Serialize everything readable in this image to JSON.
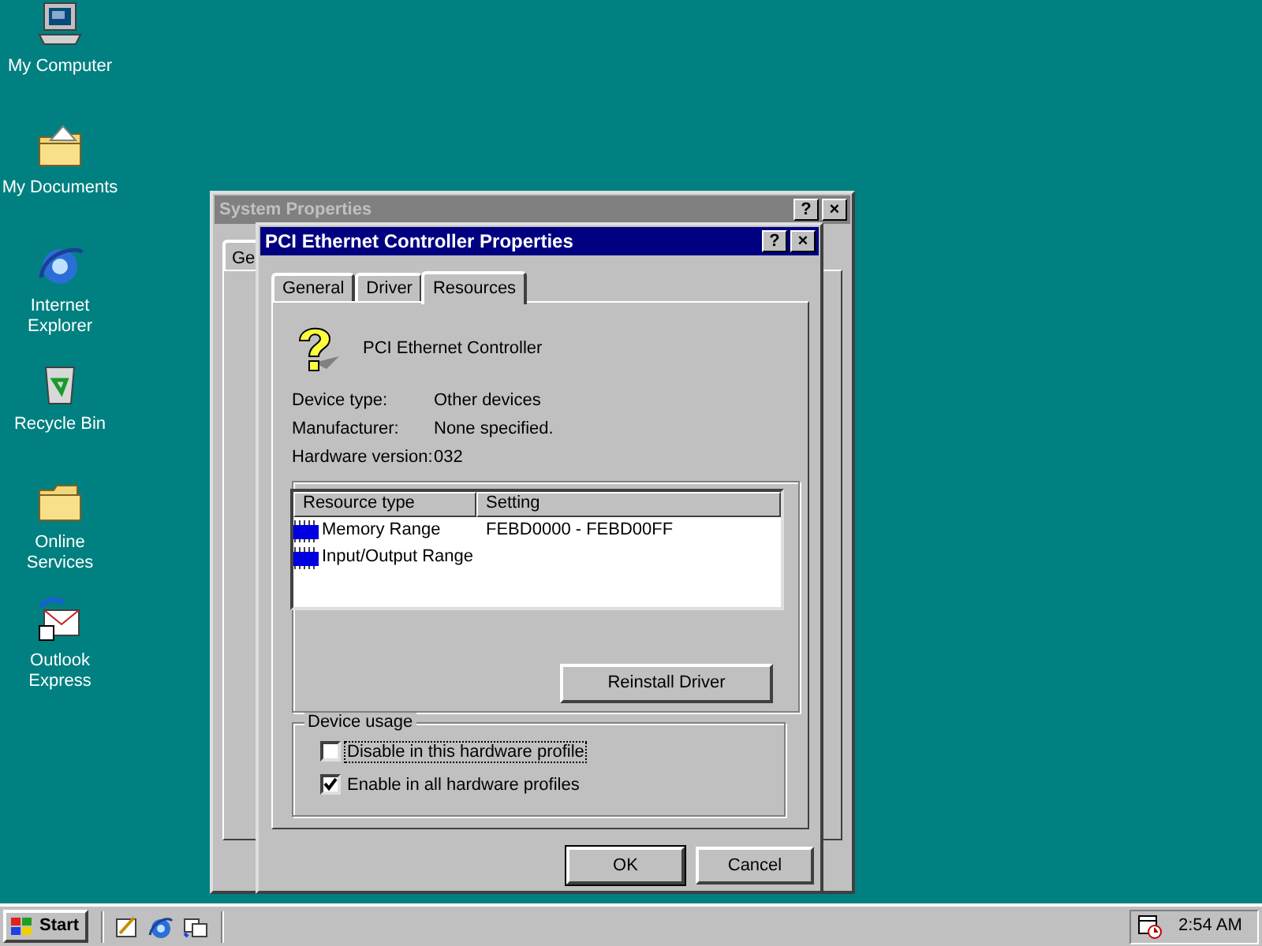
{
  "desktop_icons": [
    {
      "label": "My Computer",
      "kind": "computer"
    },
    {
      "label": "My Documents",
      "kind": "documents"
    },
    {
      "label": "Internet Explorer",
      "kind": "browser"
    },
    {
      "label": "Recycle Bin",
      "kind": "recycle"
    },
    {
      "label": "Online Services",
      "kind": "folder"
    },
    {
      "label": "Outlook Express",
      "kind": "mail"
    }
  ],
  "background_window": {
    "title": "System Properties",
    "title_buttons": [
      "?",
      "×"
    ],
    "tabs": [
      {
        "label": "Ge"
      }
    ]
  },
  "dialog": {
    "title": "PCI Ethernet Controller Properties",
    "title_buttons": [
      "?",
      "×"
    ],
    "tabs": [
      {
        "label": "General",
        "selected": false
      },
      {
        "label": "Driver",
        "selected": false
      },
      {
        "label": "Resources",
        "selected": true
      }
    ],
    "device_name": "PCI Ethernet Controller",
    "properties": [
      {
        "label": "Device type:",
        "value": "Other devices"
      },
      {
        "label": "Manufacturer:",
        "value": "None specified."
      },
      {
        "label": "Hardware version:",
        "value": "032"
      }
    ],
    "resources": {
      "columns": [
        "Resource type",
        "Setting"
      ],
      "rows": [
        {
          "type": "Memory Range",
          "setting": "FEBD0000 - FEBD00FF"
        },
        {
          "type": "Input/Output Range"
        }
      ]
    },
    "reinstall_button": "Reinstall Driver",
    "device_usage": {
      "title": "Device usage",
      "options": [
        {
          "label": "Disable in this hardware profile",
          "checked": false,
          "focused": true
        },
        {
          "label": "Enable in all hardware profiles",
          "checked": true,
          "focused": false
        }
      ]
    },
    "buttons": [
      {
        "label": "OK",
        "default": true
      },
      {
        "label": "Cancel",
        "default": false
      }
    ]
  },
  "taskbar": {
    "start": "Start",
    "clock": "2:54 AM"
  }
}
